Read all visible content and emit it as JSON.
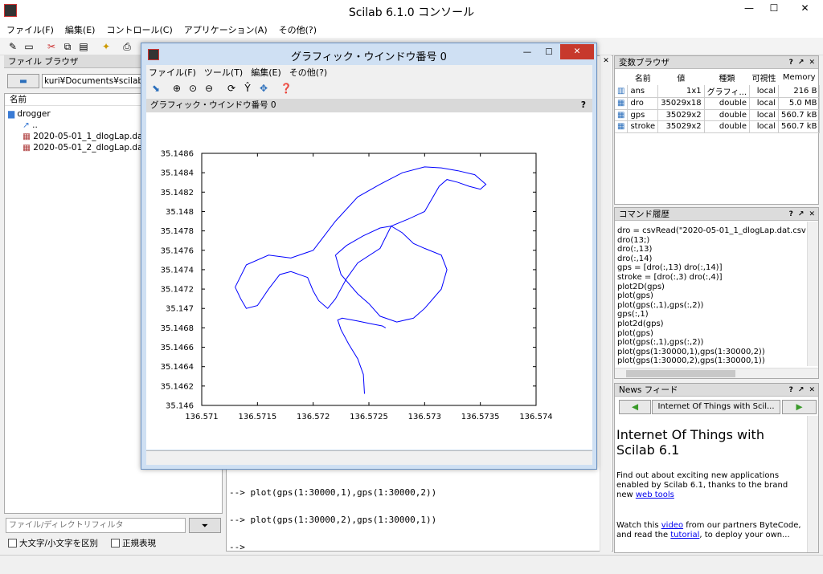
{
  "window": {
    "title": "Scilab 6.1.0 コンソール",
    "minimize": "—",
    "maximize": "☐",
    "close": "✕"
  },
  "menu": [
    "ファイル(F)",
    "編集(E)",
    "コントロール(C)",
    "アプリケーション(A)",
    "その他(?)"
  ],
  "file_browser": {
    "header": "ファイル ブラウザ",
    "path": "kuri¥Documents¥scilab¥d",
    "column": "名前",
    "items": [
      "drogger",
      "..",
      "2020-05-01_1_dlogLap.dat.cs",
      "2020-05-01_2_dlogLap.dat.cs"
    ],
    "filter_placeholder": "ファイル/ディレクトリフィルタ",
    "case_label": "大文字/小文字を区別",
    "regex_label": "正規表現"
  },
  "console": {
    "lines": [
      "--> plot(gps(1:30000,1),gps(1:30000,2))",
      "--> plot(gps(1:30000,2),gps(1:30000,1))",
      "-->"
    ]
  },
  "variables": {
    "header": "変数ブラウザ",
    "columns": [
      "名前",
      "値",
      "種類",
      "可視性",
      "Memory"
    ],
    "rows": [
      {
        "name": "ans",
        "value": "1x1",
        "type": "グラフィ...",
        "vis": "local",
        "mem": "216 B"
      },
      {
        "name": "dro",
        "value": "35029x18",
        "type": "double",
        "vis": "local",
        "mem": "5.0 MB"
      },
      {
        "name": "gps",
        "value": "35029x2",
        "type": "double",
        "vis": "local",
        "mem": "560.7 kB"
      },
      {
        "name": "stroke",
        "value": "35029x2",
        "type": "double",
        "vis": "local",
        "mem": "560.7 kB"
      }
    ]
  },
  "history": {
    "header": "コマンド履歴",
    "lines": [
      "dro = csvRead(\"2020-05-01_1_dlogLap.dat.csv\")",
      "dro(13;)",
      "dro(:,13)",
      "dro(:,14)",
      "gps = [dro(:,13) dro(:,14)]",
      "stroke = [dro(:,3) dro(:,4)]",
      "plot2D(gps)",
      "plot(gps)",
      "plot(gps(:,1),gps(:,2))",
      "gps(:,1)",
      "plot2d(gps)",
      "plot(gps)",
      "plot(gps(:,1),gps(:,2))",
      "plot(gps(1:30000,1),gps(1:30000,2))",
      "plot(gps(1:30000,2),gps(1:30000,1))"
    ]
  },
  "news": {
    "header": "News フィード",
    "nav_title": "Internet Of Things with Scil...",
    "headline": "Internet Of Things with Scilab 6.1",
    "p1": "Find out about exciting new applications enabled by Scilab 6.1, thanks to the brand new",
    "p1_link": "web tools",
    "p2a": "Watch this",
    "p2_link1": "video",
    "p2b": "from our partners ByteCode, and read the",
    "p2_link2": "tutorial",
    "p2c": ", to deploy your own..."
  },
  "graphic": {
    "title": "グラフィック・ウインドウ番号 0",
    "menu": [
      "ファイル(F)",
      "ツール(T)",
      "編集(E)",
      "その他(?)"
    ],
    "subheader": "グラフィック・ウインドウ番号 0",
    "help": "?"
  },
  "chart_data": {
    "type": "line",
    "title": "",
    "xlabel": "",
    "ylabel": "",
    "xlim": [
      136.571,
      136.574
    ],
    "ylim": [
      35.146,
      35.1486
    ],
    "x_ticks": [
      "136.571",
      "136.5715",
      "136.572",
      "136.5725",
      "136.573",
      "136.5735",
      "136.574"
    ],
    "y_ticks": [
      "35.146",
      "35.1462",
      "35.1464",
      "35.1466",
      "35.1468",
      "35.147",
      "35.1472",
      "35.1474",
      "35.1476",
      "35.1478",
      "35.148",
      "35.1482",
      "35.1484",
      "35.1486"
    ],
    "color": "#0000ff",
    "series": [
      {
        "x": [
          136.57246,
          136.57245,
          136.5724,
          136.57232,
          136.57225,
          136.57222,
          136.57226,
          136.5724,
          136.57253,
          136.57262,
          136.57265
        ],
        "y": [
          35.14612,
          35.14632,
          35.14648,
          35.14663,
          35.14678,
          35.14688,
          35.1469,
          35.14687,
          35.14684,
          35.14682,
          35.1468
        ]
      },
      {
        "x": [
          136.5713,
          136.5714,
          136.5716,
          136.5718,
          136.572,
          136.5722,
          136.5724,
          136.5726,
          136.5728,
          136.573,
          136.57315,
          136.5733,
          136.57345,
          136.57355,
          136.5735,
          136.5734,
          136.5733,
          136.5732,
          136.57313,
          136.573,
          136.57285,
          136.5727,
          136.5726,
          136.5724,
          136.5723,
          136.5722,
          136.57213,
          136.57205,
          136.572,
          136.57195,
          136.5718,
          136.5717,
          136.5716,
          136.5715,
          136.5714,
          136.57135,
          136.5713
        ],
        "y": [
          35.14722,
          35.14745,
          35.14755,
          35.14752,
          35.1476,
          35.1479,
          35.14815,
          35.14828,
          35.1484,
          35.14846,
          35.14845,
          35.14842,
          35.14838,
          35.14828,
          35.14823,
          35.14826,
          35.1483,
          35.14833,
          35.14826,
          35.148,
          35.14792,
          35.14785,
          35.14762,
          35.14747,
          35.14731,
          35.1471,
          35.147,
          35.14708,
          35.14718,
          35.14732,
          35.14738,
          35.14735,
          35.1472,
          35.14703,
          35.147,
          35.1471,
          35.14722
        ]
      },
      {
        "x": [
          136.5722,
          136.5723,
          136.57245,
          136.5726,
          136.5727,
          136.5728,
          136.5729,
          136.573,
          136.57315,
          136.5732,
          136.57315,
          136.573,
          136.5729,
          136.57275,
          136.5726,
          136.5725,
          136.5724,
          136.57225,
          136.5722
        ],
        "y": [
          35.14755,
          35.14765,
          35.14775,
          35.14783,
          35.14785,
          35.14778,
          35.14767,
          35.14762,
          35.14755,
          35.1474,
          35.1472,
          35.147,
          35.1469,
          35.14686,
          35.14692,
          35.14705,
          35.14715,
          35.14735,
          35.14755
        ]
      }
    ]
  }
}
